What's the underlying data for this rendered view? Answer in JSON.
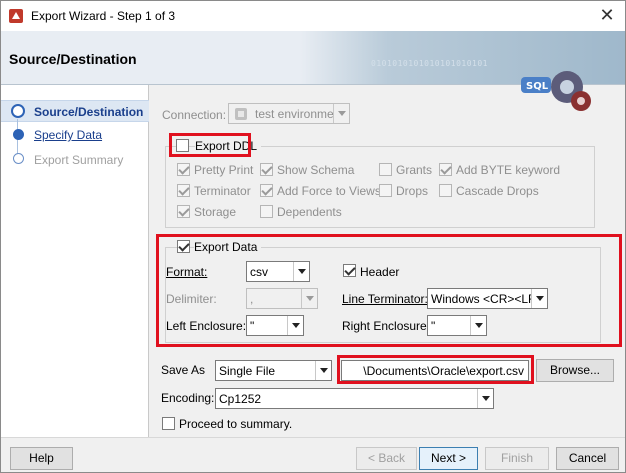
{
  "window": {
    "title": "Export Wizard - Step 1 of 3",
    "close_glyph": "✕"
  },
  "banner": {
    "title": "Source/Destination",
    "binary_text": "0101010101010101010101",
    "sql_text": "SQL"
  },
  "nav": {
    "steps": [
      {
        "label": "Source/Destination",
        "state": "active"
      },
      {
        "label": "Specify Data",
        "state": "link"
      },
      {
        "label": "Export Summary",
        "state": "disabled"
      }
    ]
  },
  "connection": {
    "label": "Connection:",
    "value": "test environment"
  },
  "ddl": {
    "export_ddl": {
      "label": "Export DDL",
      "checked": false
    },
    "options": [
      {
        "label": "Pretty Print",
        "checked": true
      },
      {
        "label": "Show Schema",
        "checked": true
      },
      {
        "label": "Grants",
        "checked": false
      },
      {
        "label": "Add BYTE keyword",
        "checked": true
      },
      {
        "label": "Terminator",
        "checked": true
      },
      {
        "label": "Add Force to Views",
        "checked": true
      },
      {
        "label": "Drops",
        "checked": false
      },
      {
        "label": "Cascade Drops",
        "checked": false
      },
      {
        "label": "Storage",
        "checked": true
      },
      {
        "label": "Dependents",
        "checked": false
      }
    ]
  },
  "data": {
    "export_data": {
      "label": "Export Data",
      "checked": true
    },
    "format": {
      "label": "Format:",
      "value": "csv"
    },
    "header": {
      "label": "Header",
      "checked": true
    },
    "delimiter": {
      "label": "Delimiter:",
      "value": ","
    },
    "line_terminator": {
      "label": "Line Terminator:",
      "value": "Windows <CR><LF>"
    },
    "left_enclosure": {
      "label": "Left Enclosure:",
      "value": "\""
    },
    "right_enclosure": {
      "label": "Right Enclosure:",
      "value": "\""
    }
  },
  "save": {
    "label": "Save As",
    "mode": "Single File",
    "path": "\\Documents\\Oracle\\export.csv",
    "browse": "Browse..."
  },
  "encoding": {
    "label": "Encoding:",
    "value": "Cp1252"
  },
  "proceed": {
    "label": "Proceed to summary.",
    "checked": false
  },
  "buttons": {
    "help": "Help",
    "back": "< Back",
    "next": "Next >",
    "finish": "Finish",
    "cancel": "Cancel"
  },
  "colors": {
    "highlight": "#e0101e",
    "nav_active": "#1a3f8c"
  }
}
